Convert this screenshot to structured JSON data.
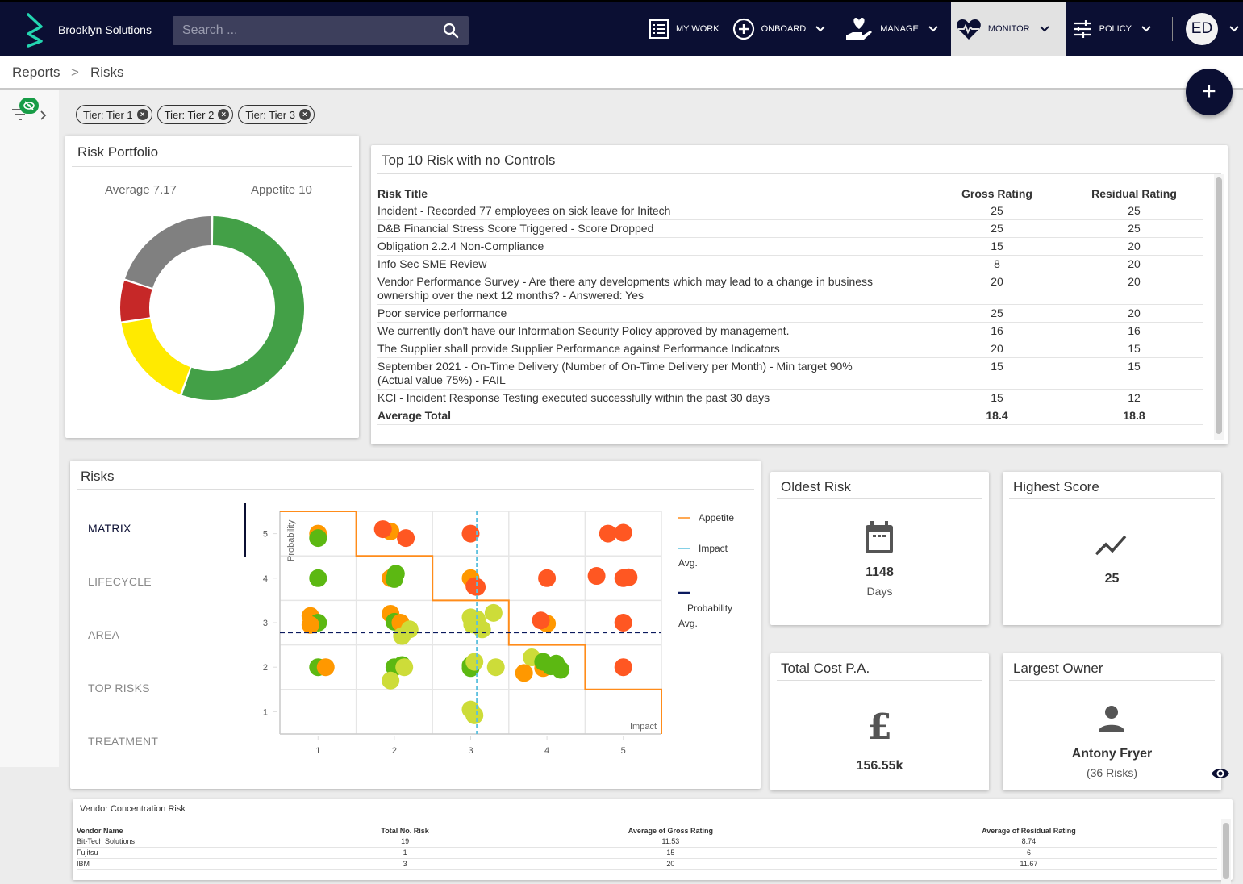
{
  "header": {
    "brand": "Brooklyn Solutions",
    "search_placeholder": "Search ...",
    "nav": [
      {
        "label": "MY WORK",
        "icon": "list-icon",
        "has_dropdown": false,
        "active": false
      },
      {
        "label": "ONBOARD",
        "icon": "plus-circle-icon",
        "has_dropdown": true,
        "active": false
      },
      {
        "label": "MANAGE",
        "icon": "heart-hand-icon",
        "has_dropdown": true,
        "active": false
      },
      {
        "label": "MONITOR",
        "icon": "heartbeat-icon",
        "has_dropdown": true,
        "active": true
      },
      {
        "label": "POLICY",
        "icon": "sliders-icon",
        "has_dropdown": true,
        "active": false
      }
    ],
    "user_initials": "ED"
  },
  "breadcrumb": {
    "items": [
      "Reports",
      "Risks"
    ],
    "separator": ">"
  },
  "fab_label": "+",
  "filters": {
    "chips": [
      "Tier: Tier 1",
      "Tier: Tier 2",
      "Tier: Tier 3"
    ]
  },
  "risk_portfolio": {
    "title": "Risk Portfolio",
    "average_label": "Average 7.17",
    "appetite_label": "Appetite 10"
  },
  "top10": {
    "title": "Top 10 Risk with no Controls",
    "columns": [
      "Risk Title",
      "Gross Rating",
      "Residual Rating"
    ],
    "rows": [
      [
        "Incident - Recorded 77 employees on sick leave for Initech",
        "25",
        "25"
      ],
      [
        "D&B Financial Stress Score Triggered - Score Dropped",
        "25",
        "25"
      ],
      [
        "Obligation 2.2.4 Non-Compliance",
        "15",
        "20"
      ],
      [
        "Info Sec SME Review",
        "8",
        "20"
      ],
      [
        "Vendor Performance Survey - Are there any developments which may lead to a change in business ownership over the next 12 months? - Answered: Yes",
        "20",
        "20"
      ],
      [
        "Poor service performance",
        "25",
        "20"
      ],
      [
        "We currently don't have our Information Security Policy approved by management.",
        "16",
        "16"
      ],
      [
        "The Supplier shall provide Supplier Performance against Performance Indicators",
        "20",
        "15"
      ],
      [
        "September 2021 - On-Time Delivery (Number of On-Time Delivery per Month) - Min target 90% (Actual value 75%) - FAIL",
        "15",
        "15"
      ],
      [
        "KCI - Incident Response Testing executed successfully within the past 30 days",
        "15",
        "12"
      ]
    ],
    "total": [
      "Average Total",
      "18.4",
      "18.8"
    ]
  },
  "risks_panel": {
    "title": "Risks",
    "tabs": [
      "MATRIX",
      "LIFECYCLE",
      "AREA",
      "TOP RISKS",
      "TREATMENT"
    ],
    "active_tab": "MATRIX"
  },
  "stats": {
    "oldest_risk": {
      "title": "Oldest Risk",
      "value": "1148",
      "unit": "Days",
      "icon": "calendar-icon"
    },
    "highest_score": {
      "title": "Highest Score",
      "value": "25",
      "icon": "trending-icon"
    },
    "total_cost": {
      "title": "Total Cost P.A.",
      "value": "156.55k",
      "icon": "pound-icon"
    },
    "largest_owner": {
      "title": "Largest Owner",
      "value": "Antony Fryer",
      "sub": "(36 Risks)",
      "icon": "person-icon"
    }
  },
  "vendor_concentration": {
    "title": "Vendor Concentration Risk",
    "columns": [
      "Vendor Name",
      "Total No. Risk",
      "Average of Gross Rating",
      "Average of Residual Rating"
    ],
    "rows": [
      [
        "Bit-Tech Solutions",
        "19",
        "11.53",
        "8.74"
      ],
      [
        "Fujitsu",
        "1",
        "15",
        "6"
      ],
      [
        "IBM",
        "3",
        "20",
        "11.67"
      ]
    ]
  },
  "colors": {
    "navy": "#0b0f33",
    "green": "#43a047",
    "yellow": "#ffea00",
    "red": "#c62828",
    "gray": "#808080",
    "appetite": "#ff8c1a",
    "impact_avg": "#5bc0de",
    "prob_avg": "#0b1a5e"
  },
  "chart_data": [
    {
      "type": "pie",
      "title": "Risk Portfolio",
      "donut": true,
      "annotations": [
        "Average 7.17",
        "Appetite 10"
      ],
      "slices": [
        {
          "name": "green",
          "value": 55.5,
          "color": "#43a047"
        },
        {
          "name": "yellow",
          "value": 17,
          "color": "#ffea00"
        },
        {
          "name": "red",
          "value": 7.5,
          "color": "#c62828"
        },
        {
          "name": "gray",
          "value": 20,
          "color": "#808080"
        }
      ]
    },
    {
      "type": "scatter",
      "title": "Risks Matrix",
      "xlabel": "Impact",
      "ylabel": "Probability",
      "xlim": [
        0.5,
        5.5
      ],
      "ylim": [
        0.5,
        5.5
      ],
      "xticks": [
        1,
        2,
        3,
        4,
        5
      ],
      "yticks": [
        1,
        2,
        3,
        4,
        5
      ],
      "grid": true,
      "legend": {
        "placement": "right",
        "entries": [
          "Appetite",
          "Impact Avg.",
          "Probability Avg."
        ]
      },
      "impact_avg": 3.08,
      "probability_avg": 2.78,
      "appetite_step": [
        [
          0.5,
          5.5
        ],
        [
          1.5,
          5.5
        ],
        [
          1.5,
          4.5
        ],
        [
          2.5,
          4.5
        ],
        [
          2.5,
          3.5
        ],
        [
          3.5,
          3.5
        ],
        [
          3.5,
          2.5
        ],
        [
          4.5,
          2.5
        ],
        [
          4.5,
          1.5
        ],
        [
          5.5,
          1.5
        ],
        [
          5.5,
          0.5
        ]
      ],
      "point_colors": {
        "red": "#ff5722",
        "orange": "#ff9800",
        "green": "#5cb812",
        "lime": "#cddc39"
      },
      "points": [
        {
          "x": 1.0,
          "y": 5.0,
          "c": "orange"
        },
        {
          "x": 1.0,
          "y": 4.9,
          "c": "green"
        },
        {
          "x": 1.95,
          "y": 5.05,
          "c": "orange"
        },
        {
          "x": 1.85,
          "y": 5.1,
          "c": "red"
        },
        {
          "x": 2.15,
          "y": 4.9,
          "c": "red"
        },
        {
          "x": 3.0,
          "y": 5.0,
          "c": "red"
        },
        {
          "x": 4.8,
          "y": 5.0,
          "c": "red"
        },
        {
          "x": 5.0,
          "y": 5.02,
          "c": "red"
        },
        {
          "x": 1.0,
          "y": 4.0,
          "c": "green"
        },
        {
          "x": 1.95,
          "y": 4.0,
          "c": "orange"
        },
        {
          "x": 2.0,
          "y": 3.98,
          "c": "green"
        },
        {
          "x": 2.02,
          "y": 4.1,
          "c": "green"
        },
        {
          "x": 3.0,
          "y": 4.0,
          "c": "orange"
        },
        {
          "x": 3.08,
          "y": 3.8,
          "c": "red"
        },
        {
          "x": 3.05,
          "y": 3.82,
          "c": "red"
        },
        {
          "x": 4.0,
          "y": 4.0,
          "c": "red"
        },
        {
          "x": 4.65,
          "y": 4.05,
          "c": "red"
        },
        {
          "x": 5.0,
          "y": 4.0,
          "c": "red"
        },
        {
          "x": 5.07,
          "y": 4.02,
          "c": "red"
        },
        {
          "x": 0.9,
          "y": 3.15,
          "c": "orange"
        },
        {
          "x": 1.0,
          "y": 3.0,
          "c": "green"
        },
        {
          "x": 0.9,
          "y": 2.95,
          "c": "orange"
        },
        {
          "x": 1.95,
          "y": 3.2,
          "c": "orange"
        },
        {
          "x": 2.0,
          "y": 3.02,
          "c": "green"
        },
        {
          "x": 2.08,
          "y": 3.0,
          "c": "orange"
        },
        {
          "x": 2.2,
          "y": 2.85,
          "c": "lime"
        },
        {
          "x": 2.1,
          "y": 2.7,
          "c": "lime"
        },
        {
          "x": 3.0,
          "y": 3.12,
          "c": "lime"
        },
        {
          "x": 3.08,
          "y": 3.08,
          "c": "lime"
        },
        {
          "x": 3.3,
          "y": 3.22,
          "c": "lime"
        },
        {
          "x": 3.15,
          "y": 2.85,
          "c": "lime"
        },
        {
          "x": 3.02,
          "y": 2.96,
          "c": "lime"
        },
        {
          "x": 4.0,
          "y": 2.98,
          "c": "orange"
        },
        {
          "x": 3.92,
          "y": 3.05,
          "c": "red"
        },
        {
          "x": 5.0,
          "y": 3.0,
          "c": "red"
        },
        {
          "x": 1.0,
          "y": 2.0,
          "c": "green"
        },
        {
          "x": 1.1,
          "y": 2.0,
          "c": "orange"
        },
        {
          "x": 2.0,
          "y": 2.0,
          "c": "green"
        },
        {
          "x": 2.1,
          "y": 2.05,
          "c": "green"
        },
        {
          "x": 2.13,
          "y": 2.0,
          "c": "lime"
        },
        {
          "x": 1.95,
          "y": 1.7,
          "c": "lime"
        },
        {
          "x": 3.0,
          "y": 1.98,
          "c": "green"
        },
        {
          "x": 3.0,
          "y": 2.04,
          "c": "green"
        },
        {
          "x": 3.05,
          "y": 2.12,
          "c": "lime"
        },
        {
          "x": 3.33,
          "y": 2.0,
          "c": "lime"
        },
        {
          "x": 3.8,
          "y": 2.22,
          "c": "lime"
        },
        {
          "x": 3.7,
          "y": 1.87,
          "c": "orange"
        },
        {
          "x": 3.95,
          "y": 1.98,
          "c": "orange"
        },
        {
          "x": 3.95,
          "y": 2.12,
          "c": "green"
        },
        {
          "x": 4.05,
          "y": 2.02,
          "c": "green"
        },
        {
          "x": 4.12,
          "y": 2.08,
          "c": "green"
        },
        {
          "x": 4.18,
          "y": 1.94,
          "c": "green"
        },
        {
          "x": 5.0,
          "y": 2.0,
          "c": "red"
        },
        {
          "x": 3.0,
          "y": 1.05,
          "c": "lime"
        },
        {
          "x": 3.05,
          "y": 0.92,
          "c": "lime"
        }
      ]
    }
  ]
}
